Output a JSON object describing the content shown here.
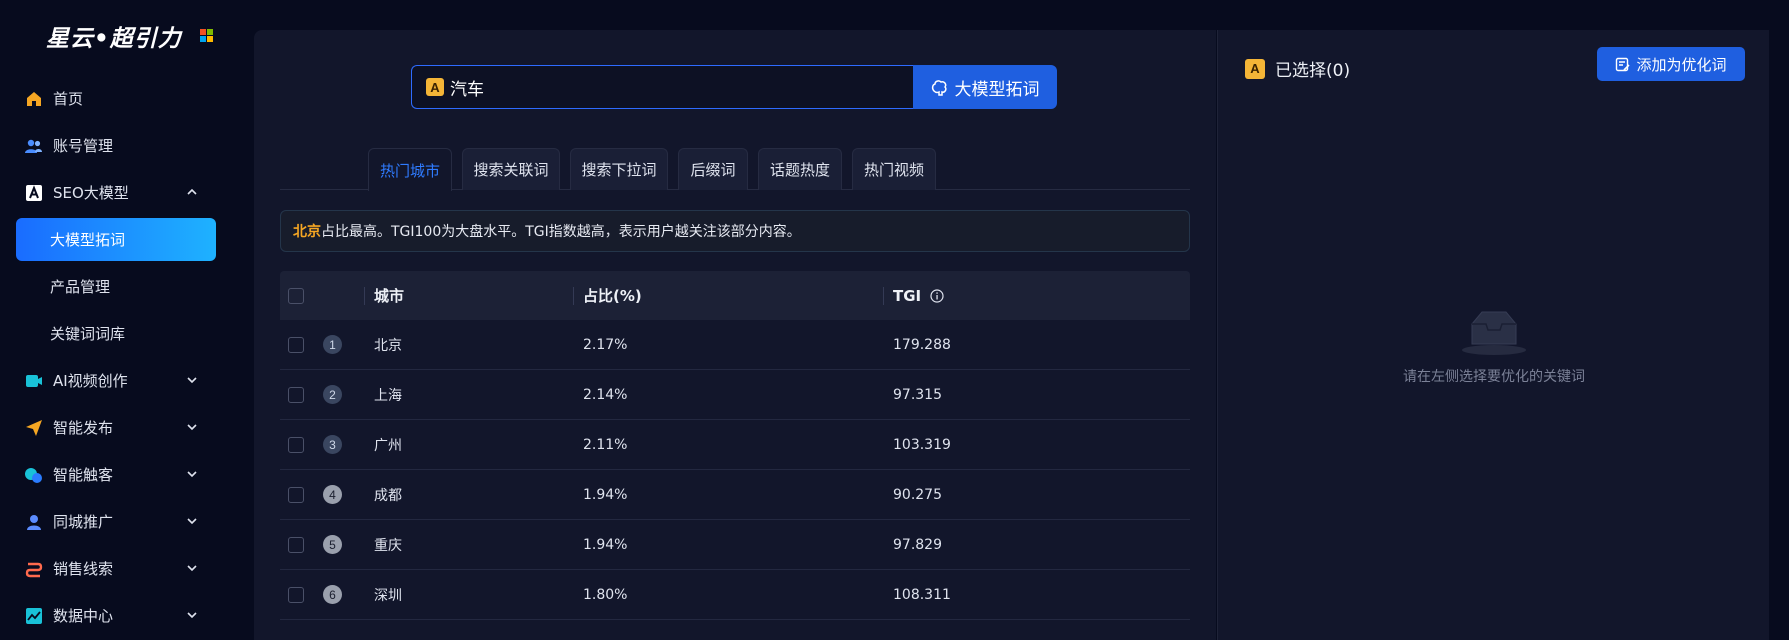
{
  "brand": {
    "logo_text": "星云•超引力"
  },
  "colors": {
    "accent": "#1f5fe0",
    "active_tab": "#2f7bff",
    "highlight": "#f5a623"
  },
  "sidebar": {
    "items": [
      {
        "label": "首页",
        "icon": "home-icon"
      },
      {
        "label": "账号管理",
        "icon": "users-icon"
      },
      {
        "label": "SEO大模型",
        "icon": "model-a-icon",
        "expanded": true,
        "children": [
          {
            "label": "大模型拓词",
            "active": true
          },
          {
            "label": "产品管理"
          },
          {
            "label": "关键词词库"
          }
        ]
      },
      {
        "label": "AI视频创作",
        "icon": "video-icon"
      },
      {
        "label": "智能发布",
        "icon": "send-icon"
      },
      {
        "label": "智能触客",
        "icon": "contact-icon"
      },
      {
        "label": "同城推广",
        "icon": "location-user-icon"
      },
      {
        "label": "销售线索",
        "icon": "leads-icon"
      },
      {
        "label": "数据中心",
        "icon": "chart-icon"
      }
    ]
  },
  "search": {
    "badge": "A",
    "value": "汽车",
    "button_label": "大模型拓词"
  },
  "tabs": [
    {
      "label": "热门城市",
      "active": true
    },
    {
      "label": "搜索关联词"
    },
    {
      "label": "搜索下拉词"
    },
    {
      "label": "后缀词"
    },
    {
      "label": "话题热度"
    },
    {
      "label": "热门视频"
    }
  ],
  "notice": {
    "highlight": "北京",
    "text": "占比最高。TGI100为大盘水平。TGI指数越高，表示用户越关注该部分内容。"
  },
  "table": {
    "headers": {
      "city": "城市",
      "ratio": "占比(%)",
      "tgi": "TGI"
    },
    "rows": [
      {
        "rank": "1",
        "city": "北京",
        "ratio": "2.17%",
        "tgi": "179.288"
      },
      {
        "rank": "2",
        "city": "上海",
        "ratio": "2.14%",
        "tgi": "97.315"
      },
      {
        "rank": "3",
        "city": "广州",
        "ratio": "2.11%",
        "tgi": "103.319"
      },
      {
        "rank": "4",
        "city": "成都",
        "ratio": "1.94%",
        "tgi": "90.275"
      },
      {
        "rank": "5",
        "city": "重庆",
        "ratio": "1.94%",
        "tgi": "97.829"
      },
      {
        "rank": "6",
        "city": "深圳",
        "ratio": "1.80%",
        "tgi": "108.311"
      }
    ]
  },
  "selection": {
    "badge": "A",
    "title": "已选择(0)",
    "add_button": "添加为优化词",
    "empty_text": "请在左侧选择要优化的关键词"
  }
}
